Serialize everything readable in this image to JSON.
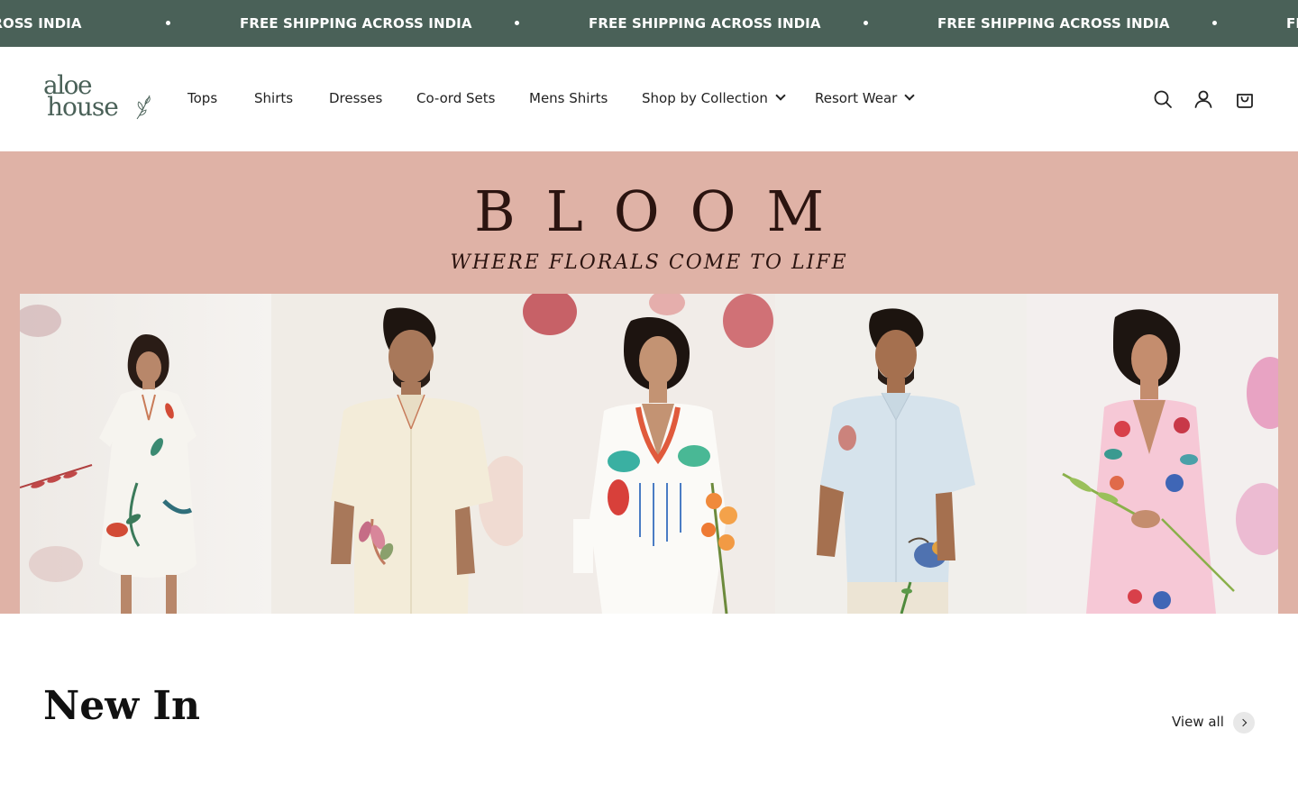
{
  "announcement": {
    "text": "FREE SHIPPING ACROSS INDIA",
    "background": "#4a6158"
  },
  "brand": {
    "line1": "aloe",
    "line2": "house",
    "color": "#4a6158"
  },
  "nav": {
    "items": [
      {
        "label": "Tops"
      },
      {
        "label": "Shirts"
      },
      {
        "label": "Dresses"
      },
      {
        "label": "Co-ord Sets"
      },
      {
        "label": "Mens Shirts"
      },
      {
        "label": "Shop by Collection",
        "dropdown": true
      },
      {
        "label": "Resort Wear",
        "dropdown": true
      }
    ]
  },
  "header_icons": [
    "search-icon",
    "account-icon",
    "cart-icon"
  ],
  "hero": {
    "title": "BLOOM",
    "subtitle": "WHERE FLORALS COME TO LIFE",
    "background": "#dfb2a6"
  },
  "section": {
    "title": "New In",
    "view_all": "View all"
  }
}
